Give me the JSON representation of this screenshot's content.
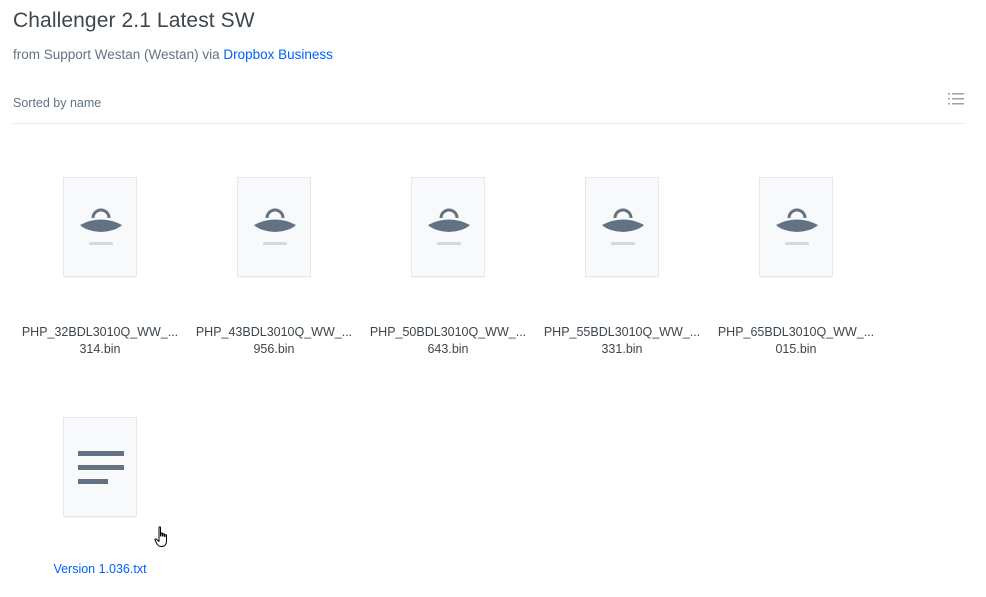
{
  "header": {
    "title": "Challenger 2.1 Latest SW",
    "from_text": "from Support Westan (Westan) via ",
    "source_link": "Dropbox Business"
  },
  "toolbar": {
    "sort_label": "Sorted by name",
    "view_icon": "list-view-icon"
  },
  "files": [
    {
      "line1": "PHP_32BDL3010Q_WW_...",
      "line2": "314.bin",
      "icon": "binary-file-icon"
    },
    {
      "line1": "PHP_43BDL3010Q_WW_...",
      "line2": "956.bin",
      "icon": "binary-file-icon"
    },
    {
      "line1": "PHP_50BDL3010Q_WW_...",
      "line2": "643.bin",
      "icon": "binary-file-icon"
    },
    {
      "line1": "PHP_55BDL3010Q_WW_...",
      "line2": "331.bin",
      "icon": "binary-file-icon"
    },
    {
      "line1": "PHP_65BDL3010Q_WW_...",
      "line2": "015.bin",
      "icon": "binary-file-icon"
    },
    {
      "line1": "Version 1.036.txt",
      "line2": "",
      "icon": "text-file-icon"
    }
  ],
  "colors": {
    "link": "#0061fe",
    "icon": "#637282",
    "muted_line": "#d4d8dc"
  }
}
